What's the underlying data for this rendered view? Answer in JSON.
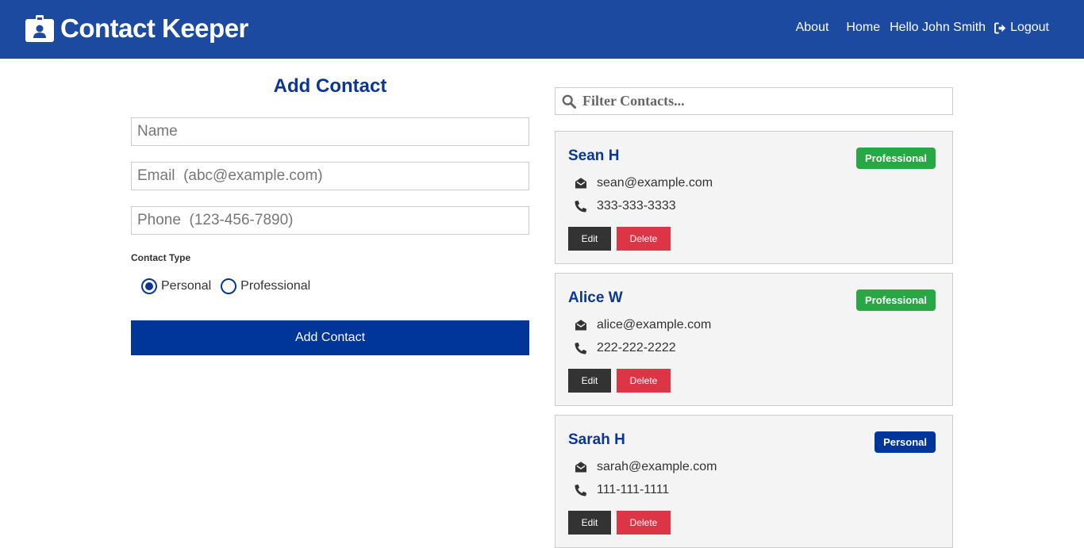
{
  "navbar": {
    "brand": "Contact Keeper",
    "brand_icon": "id-badge-icon",
    "links": {
      "about": "About",
      "home": "Home"
    },
    "greeting": "Hello John Smith",
    "logout": "Logout",
    "logout_icon": "sign-out-icon",
    "bg_color": "#1c4aa0"
  },
  "form": {
    "title": "Add Contact",
    "name_placeholder": "Name",
    "email_placeholder": "Email  (abc@example.com)",
    "phone_placeholder": "Phone  (123-456-7890)",
    "type_label": "Contact Type",
    "options": [
      {
        "label": "Personal",
        "checked": true
      },
      {
        "label": "Professional",
        "checked": false
      }
    ],
    "submit_label": "Add Contact"
  },
  "filter": {
    "placeholder": "Filter Contacts...",
    "icon": "search-icon"
  },
  "contacts": [
    {
      "name": "Sean H",
      "type": "Professional",
      "email": "sean@example.com",
      "phone": "333-333-3333",
      "edit": "Edit",
      "delete": "Delete"
    },
    {
      "name": "Alice W",
      "type": "Professional",
      "email": "alice@example.com",
      "phone": "222-222-2222",
      "edit": "Edit",
      "delete": "Delete"
    },
    {
      "name": "Sarah H",
      "type": "Personal",
      "email": "sarah@example.com",
      "phone": "111-111-1111",
      "edit": "Edit",
      "delete": "Delete"
    }
  ],
  "colors": {
    "accent": "#0b3694",
    "professional": "#28a745",
    "personal": "#003699",
    "delete": "#dc3545",
    "edit": "#333333"
  }
}
